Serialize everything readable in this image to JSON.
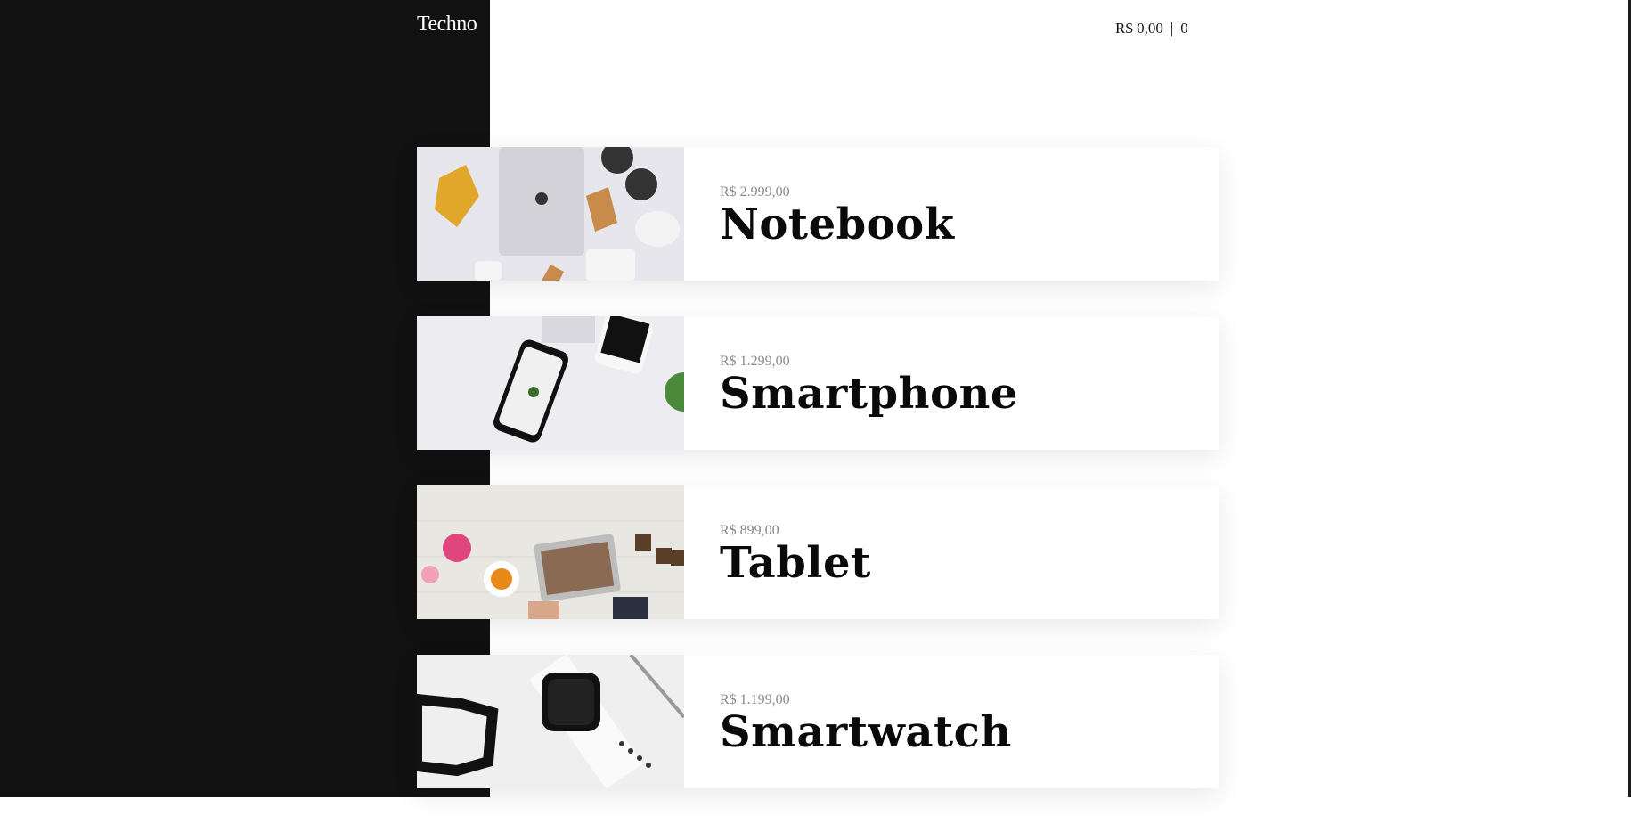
{
  "header": {
    "logo": "Techno",
    "cart_total": "R$ 0,00",
    "cart_separator": "|",
    "cart_count": "0"
  },
  "products": [
    {
      "price": "R$ 2.999,00",
      "name": "Notebook"
    },
    {
      "price": "R$ 1.299,00",
      "name": "Smartphone"
    },
    {
      "price": "R$ 899,00",
      "name": "Tablet"
    },
    {
      "price": "R$ 1.199,00",
      "name": "Smartwatch"
    }
  ]
}
